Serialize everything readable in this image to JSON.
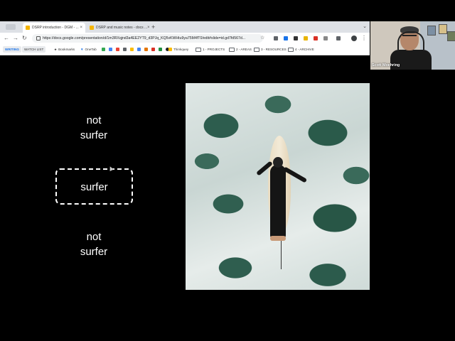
{
  "browser": {
    "tabs": [
      {
        "label": "DSRP introduction - DGM - ...",
        "active": true
      },
      {
        "label": "DSRP and music notes - docs ...",
        "active": false
      }
    ],
    "url": "https://docs.google.com/presentation/d/1m3RXqjnd3a4EE2YT9_d3PJq_KQ5vKWHtu9ya75M4fT0/edit#slide=id.gd7fd567d...",
    "bookmarks": {
      "pill_writing": "WRITING",
      "pill_watchlist": "WATCH LIST",
      "items": [
        "Bookmarks",
        "OneTab",
        "Thinkquey",
        "1 - PROJECTS",
        "2 - AREAS",
        "3 - RESOURCES",
        "4 - ARCHIVE"
      ]
    }
  },
  "video_call": {
    "participant_name": "Scott Moehring"
  },
  "slide": {
    "labels": {
      "top": "not surfer",
      "middle": "surfer",
      "bottom": "not surfer"
    },
    "photo_alt": "Aerial view of a surfer lying on a surfboard in whitewater"
  }
}
